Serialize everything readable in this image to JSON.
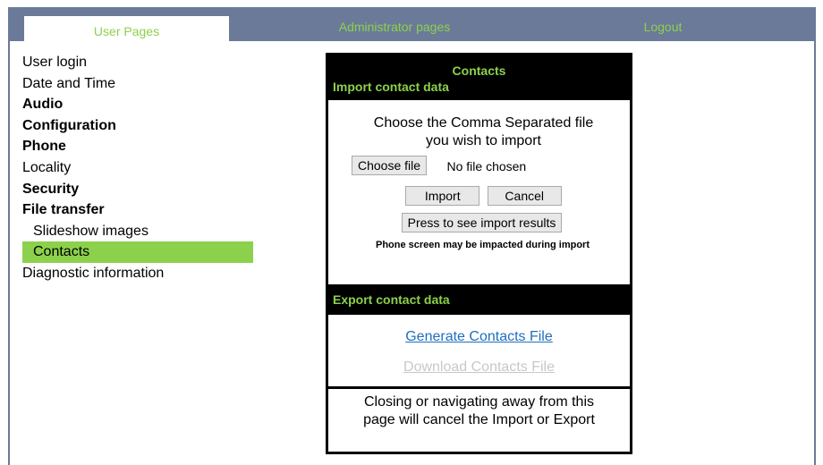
{
  "tabs": {
    "user": "User Pages",
    "admin": "Administrator pages",
    "logout": "Logout"
  },
  "sidebar": {
    "items": [
      {
        "label": "User login"
      },
      {
        "label": "Date and Time"
      },
      {
        "label": "Audio"
      },
      {
        "label": "Configuration"
      },
      {
        "label": "Phone"
      },
      {
        "label": "Locality"
      },
      {
        "label": "Security"
      },
      {
        "label": "File transfer"
      },
      {
        "label": "Slideshow images"
      },
      {
        "label": "Contacts"
      },
      {
        "label": "Diagnostic information"
      }
    ]
  },
  "panel": {
    "title": "Contacts",
    "import_heading": "Import contact data",
    "choose_line1": "Choose the Comma Separated file",
    "choose_line2": "you wish to import",
    "choose_file_button": "Choose file",
    "file_status": "No file chosen",
    "import_button": "Import",
    "cancel_button": "Cancel",
    "results_button": "Press to see import results",
    "warning": "Phone screen may be impacted during import",
    "export_heading": "Export contact data",
    "generate_link": "Generate Contacts File",
    "download_link": "Download Contacts File",
    "notice": "Closing or navigating away from this page will cancel the Import or Export"
  },
  "colors": {
    "accent_green": "#8cd14b",
    "topbar": "#6b7a99",
    "link_blue": "#1f6fbf",
    "disabled_link": "#c8c8c8"
  }
}
